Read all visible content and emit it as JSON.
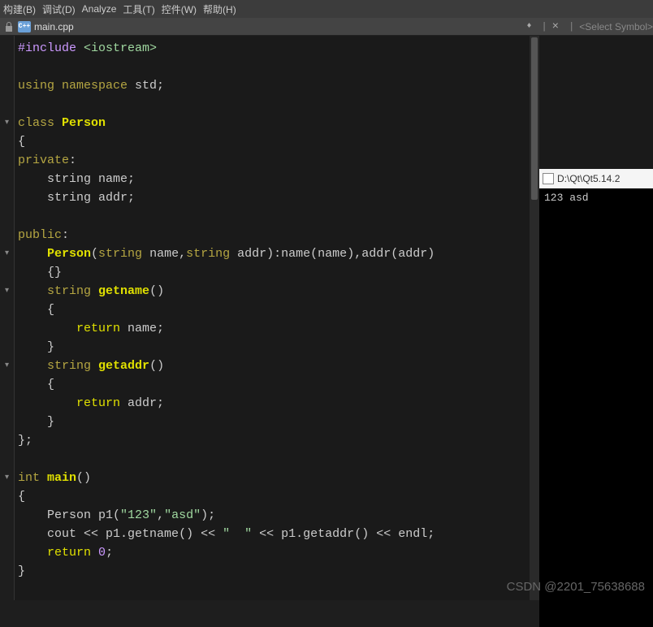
{
  "menubar": {
    "items": [
      "构建(B)",
      "调试(D)",
      "Analyze",
      "工具(T)",
      "控件(W)",
      "帮助(H)"
    ]
  },
  "tab": {
    "file_icon_label": "C++",
    "filename": "main.cpp",
    "symbol_placeholder": "<Select Symbol>"
  },
  "code": {
    "lines": [
      {
        "fold": "",
        "tokens": [
          [
            "kw-preproc",
            "#include "
          ],
          [
            "angle-header",
            "<iostream>"
          ]
        ]
      },
      {
        "fold": "",
        "tokens": []
      },
      {
        "fold": "",
        "tokens": [
          [
            "kw-olive",
            "using "
          ],
          [
            "kw-olive",
            "namespace "
          ],
          [
            "ident",
            "std"
          ],
          [
            "punct",
            ";"
          ]
        ]
      },
      {
        "fold": "",
        "tokens": []
      },
      {
        "fold": "▾",
        "tokens": [
          [
            "kw-olive",
            "class "
          ],
          [
            "type",
            "Person"
          ]
        ]
      },
      {
        "fold": "",
        "tokens": [
          [
            "punct",
            "{"
          ]
        ]
      },
      {
        "fold": "",
        "tokens": [
          [
            "kw-olive",
            "private"
          ],
          [
            "punct",
            ":"
          ]
        ]
      },
      {
        "fold": "",
        "tokens": [
          [
            "ident",
            "    string name"
          ],
          [
            "punct",
            ";"
          ]
        ]
      },
      {
        "fold": "",
        "tokens": [
          [
            "ident",
            "    string addr"
          ],
          [
            "punct",
            ";"
          ]
        ]
      },
      {
        "fold": "",
        "tokens": []
      },
      {
        "fold": "",
        "tokens": [
          [
            "kw-olive",
            "public"
          ],
          [
            "punct",
            ":"
          ]
        ]
      },
      {
        "fold": "▾",
        "tokens": [
          [
            "ident",
            "    "
          ],
          [
            "func",
            "Person"
          ],
          [
            "punct",
            "("
          ],
          [
            "kw-olive",
            "string"
          ],
          [
            "ident",
            " name"
          ],
          [
            "punct",
            ","
          ],
          [
            "kw-olive",
            "string"
          ],
          [
            "ident",
            " addr"
          ],
          [
            "punct",
            "):"
          ],
          [
            "ident",
            "name"
          ],
          [
            "punct",
            "("
          ],
          [
            "ident",
            "name"
          ],
          [
            "punct",
            "),"
          ],
          [
            "ident",
            "addr"
          ],
          [
            "punct",
            "("
          ],
          [
            "ident",
            "addr"
          ],
          [
            "punct",
            ")"
          ]
        ]
      },
      {
        "fold": "",
        "tokens": [
          [
            "punct",
            "    {}"
          ]
        ]
      },
      {
        "fold": "▾",
        "tokens": [
          [
            "ident",
            "    "
          ],
          [
            "kw-olive",
            "string"
          ],
          [
            "ident",
            " "
          ],
          [
            "func",
            "getname"
          ],
          [
            "punct",
            "()"
          ]
        ]
      },
      {
        "fold": "",
        "tokens": [
          [
            "punct",
            "    {"
          ]
        ]
      },
      {
        "fold": "",
        "tokens": [
          [
            "ident",
            "        "
          ],
          [
            "kw-yellow",
            "return"
          ],
          [
            "ident",
            " name"
          ],
          [
            "punct",
            ";"
          ]
        ]
      },
      {
        "fold": "",
        "tokens": [
          [
            "punct",
            "    }"
          ]
        ]
      },
      {
        "fold": "▾",
        "tokens": [
          [
            "ident",
            "    "
          ],
          [
            "kw-olive",
            "string"
          ],
          [
            "ident",
            " "
          ],
          [
            "func",
            "getaddr"
          ],
          [
            "punct",
            "()"
          ]
        ]
      },
      {
        "fold": "",
        "tokens": [
          [
            "punct",
            "    {"
          ]
        ]
      },
      {
        "fold": "",
        "tokens": [
          [
            "ident",
            "        "
          ],
          [
            "kw-yellow",
            "return"
          ],
          [
            "ident",
            " addr"
          ],
          [
            "punct",
            ";"
          ]
        ]
      },
      {
        "fold": "",
        "tokens": [
          [
            "punct",
            "    }"
          ]
        ]
      },
      {
        "fold": "",
        "tokens": [
          [
            "punct",
            "};"
          ]
        ]
      },
      {
        "fold": "",
        "tokens": []
      },
      {
        "fold": "▾",
        "tokens": [
          [
            "kw-olive",
            "int "
          ],
          [
            "func",
            "main"
          ],
          [
            "punct",
            "()"
          ]
        ]
      },
      {
        "fold": "",
        "tokens": [
          [
            "punct",
            "{"
          ]
        ]
      },
      {
        "fold": "",
        "tokens": [
          [
            "ident",
            "    Person p1"
          ],
          [
            "punct",
            "("
          ],
          [
            "str",
            "\"123\""
          ],
          [
            "punct",
            ","
          ],
          [
            "str",
            "\"asd\""
          ],
          [
            "punct",
            ");"
          ]
        ]
      },
      {
        "fold": "",
        "tokens": [
          [
            "ident",
            "    cout "
          ],
          [
            "op",
            "<<"
          ],
          [
            "ident",
            " p1.getname"
          ],
          [
            "punct",
            "() "
          ],
          [
            "op",
            "<<"
          ],
          [
            "ident",
            " "
          ],
          [
            "str",
            "\"  \""
          ],
          [
            "ident",
            " "
          ],
          [
            "op",
            "<<"
          ],
          [
            "ident",
            " p1.getaddr"
          ],
          [
            "punct",
            "() "
          ],
          [
            "op",
            "<<"
          ],
          [
            "ident",
            " endl"
          ],
          [
            "punct",
            ";"
          ]
        ]
      },
      {
        "fold": "",
        "tokens": [
          [
            "ident",
            "    "
          ],
          [
            "kw-yellow",
            "return"
          ],
          [
            "ident",
            " "
          ],
          [
            "num",
            "0"
          ],
          [
            "punct",
            ";"
          ]
        ]
      },
      {
        "fold": "",
        "tokens": [
          [
            "punct",
            "}"
          ]
        ]
      }
    ]
  },
  "console": {
    "title": "D:\\Qt\\Qt5.14.2",
    "output": "123  asd"
  },
  "watermark": "CSDN @2201_75638688"
}
